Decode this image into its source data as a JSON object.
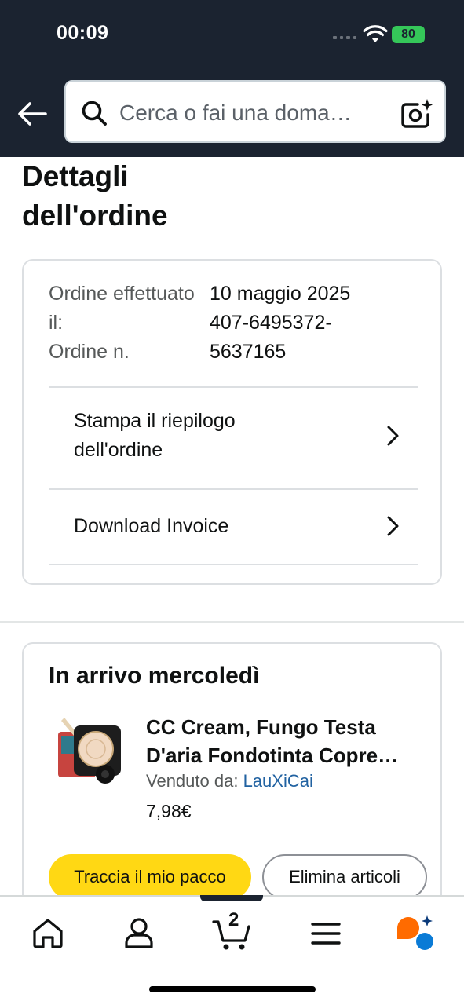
{
  "status_bar": {
    "time": "00:09",
    "battery": "80"
  },
  "search": {
    "placeholder": "Cerca o fai una doma…"
  },
  "page": {
    "title": "Dettagli dell'ordine"
  },
  "order_info": {
    "date_label": "Ordine effettuato il:",
    "date_value": "10 maggio 2025",
    "number_label": "Ordine n.",
    "number_value": "407-6495372-5637165",
    "actions": [
      {
        "label": "Stampa il riepilogo dell'ordine"
      },
      {
        "label": "Download Invoice"
      }
    ]
  },
  "shipment": {
    "title": "In arrivo mercoledì",
    "product": {
      "title": "CC Cream, Fungo Testa D'aria Fondotinta Copre…",
      "seller_label": "Venduto da: ",
      "seller_name": "LauXiCai",
      "price": "7,98€"
    },
    "track_button": "Traccia il mio pacco",
    "remove_button": "Elimina articoli"
  },
  "tabbar": {
    "items": [
      "home-icon",
      "account-icon",
      "cart-icon",
      "menu-icon",
      "rufus-icon"
    ],
    "cart_count": "2"
  },
  "colors": {
    "header_bg": "#1b2330",
    "primary_button": "#ffd814",
    "link": "#2162a1",
    "battery": "#35c759",
    "rufus_orange": "#ff6b00",
    "rufus_blue": "#0a7bd6"
  }
}
